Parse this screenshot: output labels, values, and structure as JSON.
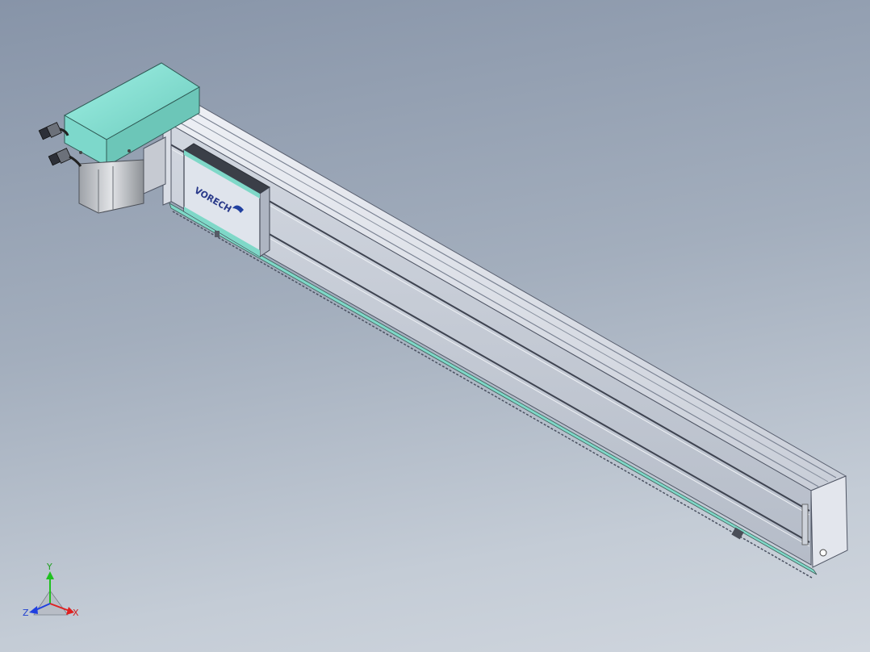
{
  "viewport": {
    "background_top": "#8794a8",
    "background_bottom": "#d0d6de"
  },
  "model": {
    "brand_logo_text": "VORECH",
    "colors": {
      "motor_housing": "#86e0d4",
      "aluminum_profile": "#d6dae3",
      "carriage_plate": "#dfe4ec",
      "accent_strip": "#7fd8c8",
      "motor_body": "#c9ccd0"
    }
  },
  "triad": {
    "x_label": "X",
    "y_label": "Y",
    "z_label": "Z",
    "x_color": "#e02020",
    "y_color": "#20c020",
    "z_color": "#2040e0"
  }
}
